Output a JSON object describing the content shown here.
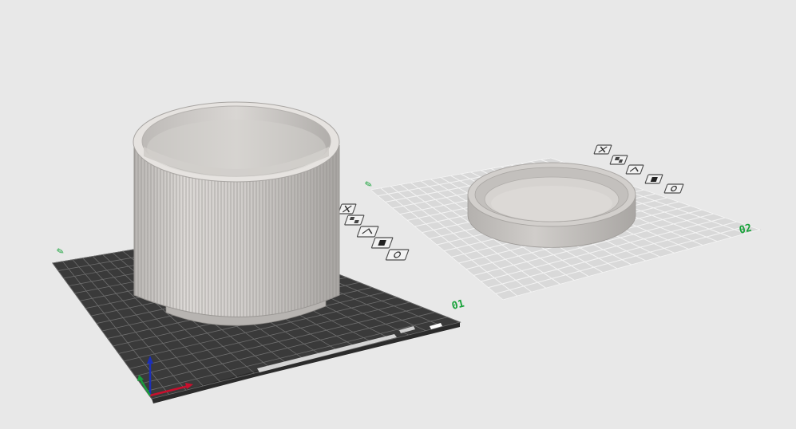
{
  "plates": [
    {
      "number_label": "01",
      "state": "active",
      "surface": "textured-dark",
      "object": "ribbed-cup"
    },
    {
      "number_label": "02",
      "state": "inactive",
      "surface": "light-grid",
      "object": "round-lid"
    }
  ],
  "plate_toolbar_icons": [
    "delete-plate-icon",
    "arrange-plate-icon",
    "orient-plate-icon",
    "lock-plate-icon",
    "plate-settings-icon"
  ],
  "axis_colors": {
    "x": "#c8102e",
    "y": "#1a9e3c",
    "z": "#1c2fb8"
  },
  "colors": {
    "background": "#e8e8e8",
    "active_plate": "#3a3a3a",
    "inactive_plate": "#d9d9d9",
    "plate_number": "#18a23a",
    "model": "#c9c6c3"
  }
}
